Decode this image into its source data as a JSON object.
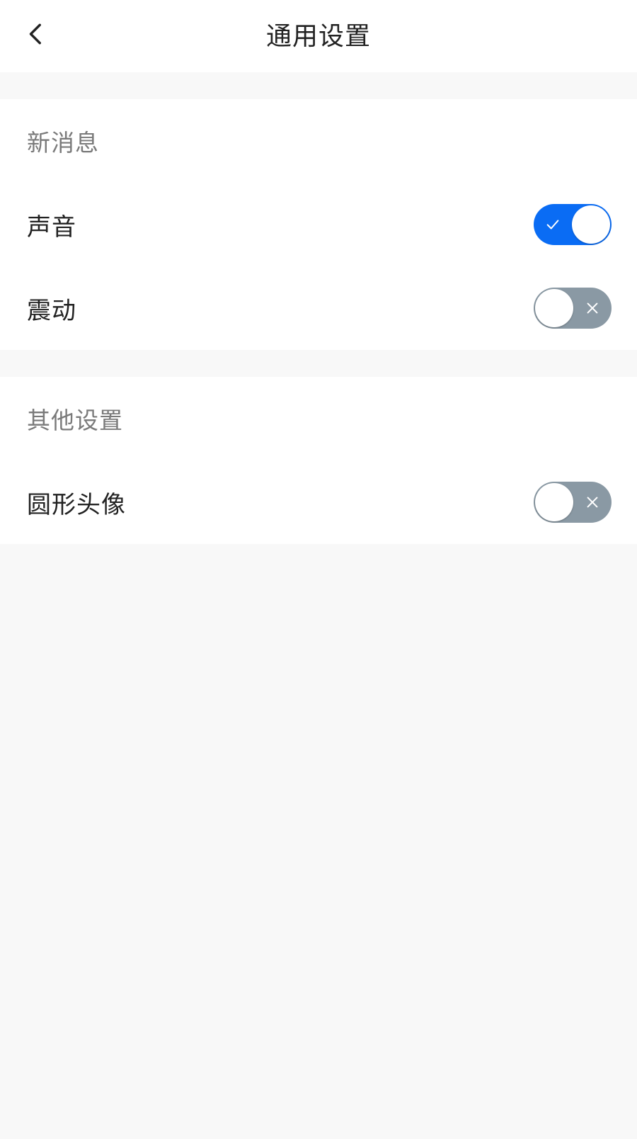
{
  "header": {
    "title": "通用设置",
    "back_icon": "chevron-left-icon"
  },
  "sections": [
    {
      "title": "新消息",
      "items": [
        {
          "label": "声音",
          "enabled": true
        },
        {
          "label": "震动",
          "enabled": false
        }
      ]
    },
    {
      "title": "其他设置",
      "items": [
        {
          "label": "圆形头像",
          "enabled": false
        }
      ]
    }
  ],
  "colors": {
    "toggle_on": "#0a6cf4",
    "toggle_off": "#8a99a4",
    "background": "#f8f8f8",
    "surface": "#ffffff",
    "section_title": "#7a7a7a"
  }
}
